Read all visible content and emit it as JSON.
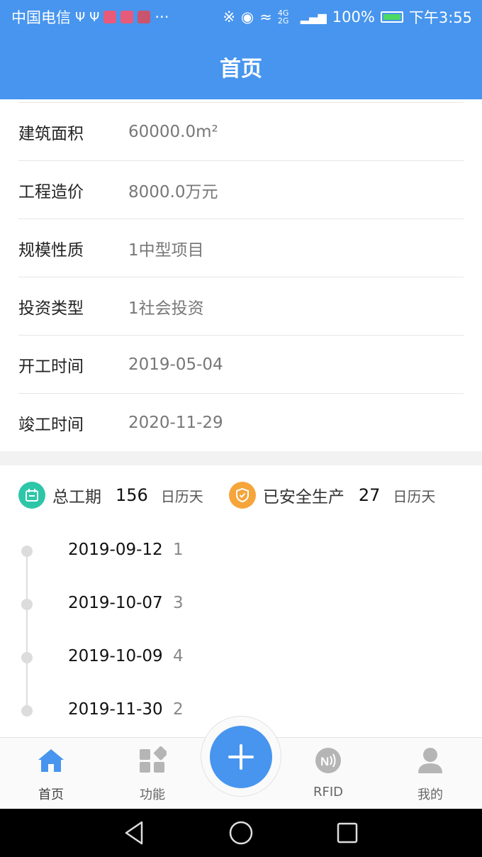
{
  "status_bar": {
    "carrier": "中国电信",
    "battery": "100%",
    "time": "下午3:55",
    "network": "4G 2G"
  },
  "header": {
    "title": "首页"
  },
  "project_info": [
    {
      "label": "建筑面积",
      "value": "60000.0m²"
    },
    {
      "label": "工程造价",
      "value": "8000.0万元"
    },
    {
      "label": "规模性质",
      "value": "1中型项目"
    },
    {
      "label": "投资类型",
      "value": "1社会投资"
    },
    {
      "label": "开工时间",
      "value": "2019-05-04"
    },
    {
      "label": "竣工时间",
      "value": "2020-11-29"
    }
  ],
  "stats": {
    "total_period": {
      "label": "总工期",
      "value": "156",
      "unit": "日历天",
      "icon": "calendar-icon",
      "color": "#2dc6a8"
    },
    "safe_days": {
      "label": "已安全生产",
      "value": "27",
      "unit": "日历天",
      "icon": "shield-icon",
      "color": "#f5a53a"
    }
  },
  "timeline": [
    {
      "date": "2019-09-12",
      "count": "1"
    },
    {
      "date": "2019-10-07",
      "count": "3"
    },
    {
      "date": "2019-10-09",
      "count": "4"
    },
    {
      "date": "2019-11-30",
      "count": "2"
    }
  ],
  "bottom_nav": {
    "items": [
      {
        "label": "首页",
        "icon": "home-icon"
      },
      {
        "label": "功能",
        "icon": "grid-icon"
      },
      {
        "label": "RFID",
        "icon": "nfc-icon"
      },
      {
        "label": "我的",
        "icon": "person-icon"
      }
    ],
    "fab_icon": "plus-icon"
  },
  "colors": {
    "accent": "#4795ee",
    "active_nav": "#4795ee",
    "inactive_nav": "#b5b5b5"
  }
}
